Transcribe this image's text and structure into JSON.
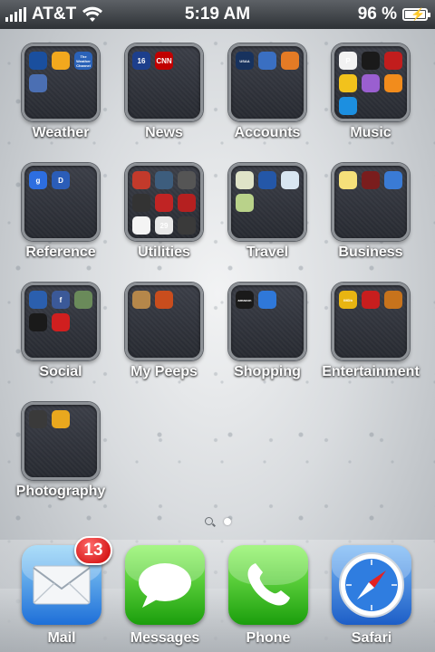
{
  "status_bar": {
    "carrier": "AT&T",
    "time": "5:19 AM",
    "battery_percent": "96 %"
  },
  "folders": [
    {
      "label": "Weather",
      "apps": [
        {
          "icon": "weather-channel-icon",
          "color": "#1a4f9e",
          "text": ""
        },
        {
          "icon": "sun-icon",
          "color": "#f2a81e",
          "text": ""
        },
        {
          "icon": "weather-channel-icon",
          "color": "#2a62b8",
          "text": "The Weather Channel"
        },
        {
          "icon": "clock-icon",
          "color": "#4b6fb3",
          "text": ""
        }
      ]
    },
    {
      "label": "News",
      "apps": [
        {
          "icon": "news-channel-icon",
          "color": "#1d3f8c",
          "text": "16"
        },
        {
          "icon": "cnn-icon",
          "color": "#c00000",
          "text": "CNN"
        }
      ]
    },
    {
      "label": "Accounts",
      "apps": [
        {
          "icon": "usaa-icon",
          "color": "#17325e",
          "text": "USAA"
        },
        {
          "icon": "bank-icon",
          "color": "#3a6fc2",
          "text": ""
        },
        {
          "icon": "stack-icon",
          "color": "#e47b25",
          "text": ""
        }
      ]
    },
    {
      "label": "Music",
      "apps": [
        {
          "icon": "pandora-icon",
          "color": "#f2f2f2",
          "text": "P"
        },
        {
          "icon": "shazam-like-icon",
          "color": "#1a1a1a",
          "text": ""
        },
        {
          "icon": "iheart-icon",
          "color": "#c21d1d",
          "text": ""
        },
        {
          "icon": "face-icon",
          "color": "#f2c21c",
          "text": ""
        },
        {
          "icon": "itunes-icon",
          "color": "#9a5fd0",
          "text": ""
        },
        {
          "icon": "ipod-icon",
          "color": "#f28c1c",
          "text": ""
        },
        {
          "icon": "shazam-icon",
          "color": "#1c8fe0",
          "text": ""
        }
      ]
    },
    {
      "label": "Reference",
      "apps": [
        {
          "icon": "google-icon",
          "color": "#2d6ee0",
          "text": "g"
        },
        {
          "icon": "dictionary-icon",
          "color": "#2b5db8",
          "text": "D"
        }
      ]
    },
    {
      "label": "Utilities",
      "apps": [
        {
          "icon": "calculator-icon",
          "color": "#c23a2b",
          "text": ""
        },
        {
          "icon": "compass-icon",
          "color": "#3d5d7d",
          "text": ""
        },
        {
          "icon": "gauge-icon",
          "color": "#555",
          "text": ""
        },
        {
          "icon": "flashlight-icon",
          "color": "#333",
          "text": ""
        },
        {
          "icon": "calendar-icon",
          "color": "#c02424",
          "text": ""
        },
        {
          "icon": "voice-memo-icon",
          "color": "#b52020",
          "text": ""
        },
        {
          "icon": "clock-icon",
          "color": "#f4f4f4",
          "text": ""
        },
        {
          "icon": "calendar-icon",
          "color": "#e8e8e8",
          "text": "29"
        },
        {
          "icon": "calculator-icon",
          "color": "#3a3a3a",
          "text": ""
        }
      ]
    },
    {
      "label": "Travel",
      "apps": [
        {
          "icon": "maps-icon",
          "color": "#dfe3c8",
          "text": ""
        },
        {
          "icon": "globe-icon",
          "color": "#2457a8",
          "text": ""
        },
        {
          "icon": "flight-icon",
          "color": "#d8e6f2",
          "text": ""
        },
        {
          "icon": "map-pin-icon",
          "color": "#b9d28a",
          "text": ""
        }
      ]
    },
    {
      "label": "Business",
      "apps": [
        {
          "icon": "notes-icon",
          "color": "#f5e07a",
          "text": ""
        },
        {
          "icon": "book-icon",
          "color": "#7a1d1d",
          "text": ""
        },
        {
          "icon": "stocks-icon",
          "color": "#3a7bd5",
          "text": ""
        }
      ]
    },
    {
      "label": "Social",
      "apps": [
        {
          "icon": "phone-voice-icon",
          "color": "#2b5fae",
          "text": ""
        },
        {
          "icon": "facebook-icon",
          "color": "#3b5998",
          "text": "f"
        },
        {
          "icon": "chat-icon",
          "color": "#6a8a5a",
          "text": ""
        },
        {
          "icon": "camera-icon",
          "color": "#1a1a1a",
          "text": ""
        },
        {
          "icon": "social-app-icon",
          "color": "#d01f1f",
          "text": ""
        }
      ]
    },
    {
      "label": "My Peeps",
      "apps": [
        {
          "icon": "contacts-icon",
          "color": "#b5874a",
          "text": ""
        },
        {
          "icon": "game-character-icon",
          "color": "#c94d1d",
          "text": ""
        }
      ]
    },
    {
      "label": "Shopping",
      "apps": [
        {
          "icon": "amazon-icon",
          "color": "#1a1a1a",
          "text": "amazon"
        },
        {
          "icon": "app-store-icon",
          "color": "#2f78d9",
          "text": ""
        }
      ]
    },
    {
      "label": "Entertainment",
      "apps": [
        {
          "icon": "imdb-icon",
          "color": "#e8b512",
          "text": "IMDb"
        },
        {
          "icon": "movies-icon",
          "color": "#c81e1e",
          "text": ""
        },
        {
          "icon": "ibooks-icon",
          "color": "#c7731c",
          "text": ""
        }
      ]
    },
    {
      "label": "Photography",
      "apps": [
        {
          "icon": "camera-icon",
          "color": "#3a3a3a",
          "text": ""
        },
        {
          "icon": "sunflower-icon",
          "color": "#e9a81e",
          "text": ""
        }
      ]
    }
  ],
  "pager": {
    "current_page": 1
  },
  "dock": [
    {
      "label": "Mail",
      "badge": "13"
    },
    {
      "label": "Messages"
    },
    {
      "label": "Phone"
    },
    {
      "label": "Safari"
    }
  ]
}
